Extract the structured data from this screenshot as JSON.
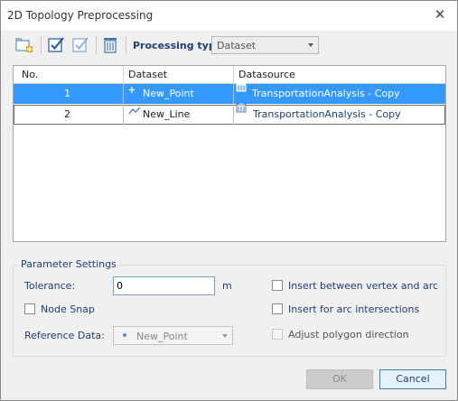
{
  "window": {
    "title": "2D Topology Preprocessing"
  },
  "toolbar": {
    "processing_type_label": "Processing type:",
    "processing_type_value": "Dataset"
  },
  "grid": {
    "columns": [
      "No.",
      "Dataset",
      "Datasource"
    ],
    "rows": [
      {
        "no": "1",
        "dataset": "New_Point",
        "dataset_icon": "point-dataset-icon",
        "datasource": "TransportationAnalysis - Copy",
        "datasource_icon": "database-icon"
      },
      {
        "no": "2",
        "dataset": "New_Line",
        "dataset_icon": "line-dataset-icon",
        "datasource": "TransportationAnalysis - Copy",
        "datasource_icon": "database-icon"
      }
    ]
  },
  "params": {
    "title": "Parameter Settings",
    "tolerance_label": "Tolerance:",
    "tolerance_value": "0",
    "tolerance_unit": "m",
    "node_snap_label": "Node Snap",
    "reference_label": "Reference Data:",
    "reference_value": "New_Point",
    "insert_vertex_arc_label": "Insert between vertex and arc",
    "insert_arc_intersections_label": "Insert for arc intersections",
    "adjust_polygon_label": "Adjust polygon direction"
  },
  "buttons": {
    "ok": "OK",
    "cancel": "Cancel"
  },
  "colors": {
    "selection": "#3399ff",
    "label_blue": "#1f3e73"
  }
}
